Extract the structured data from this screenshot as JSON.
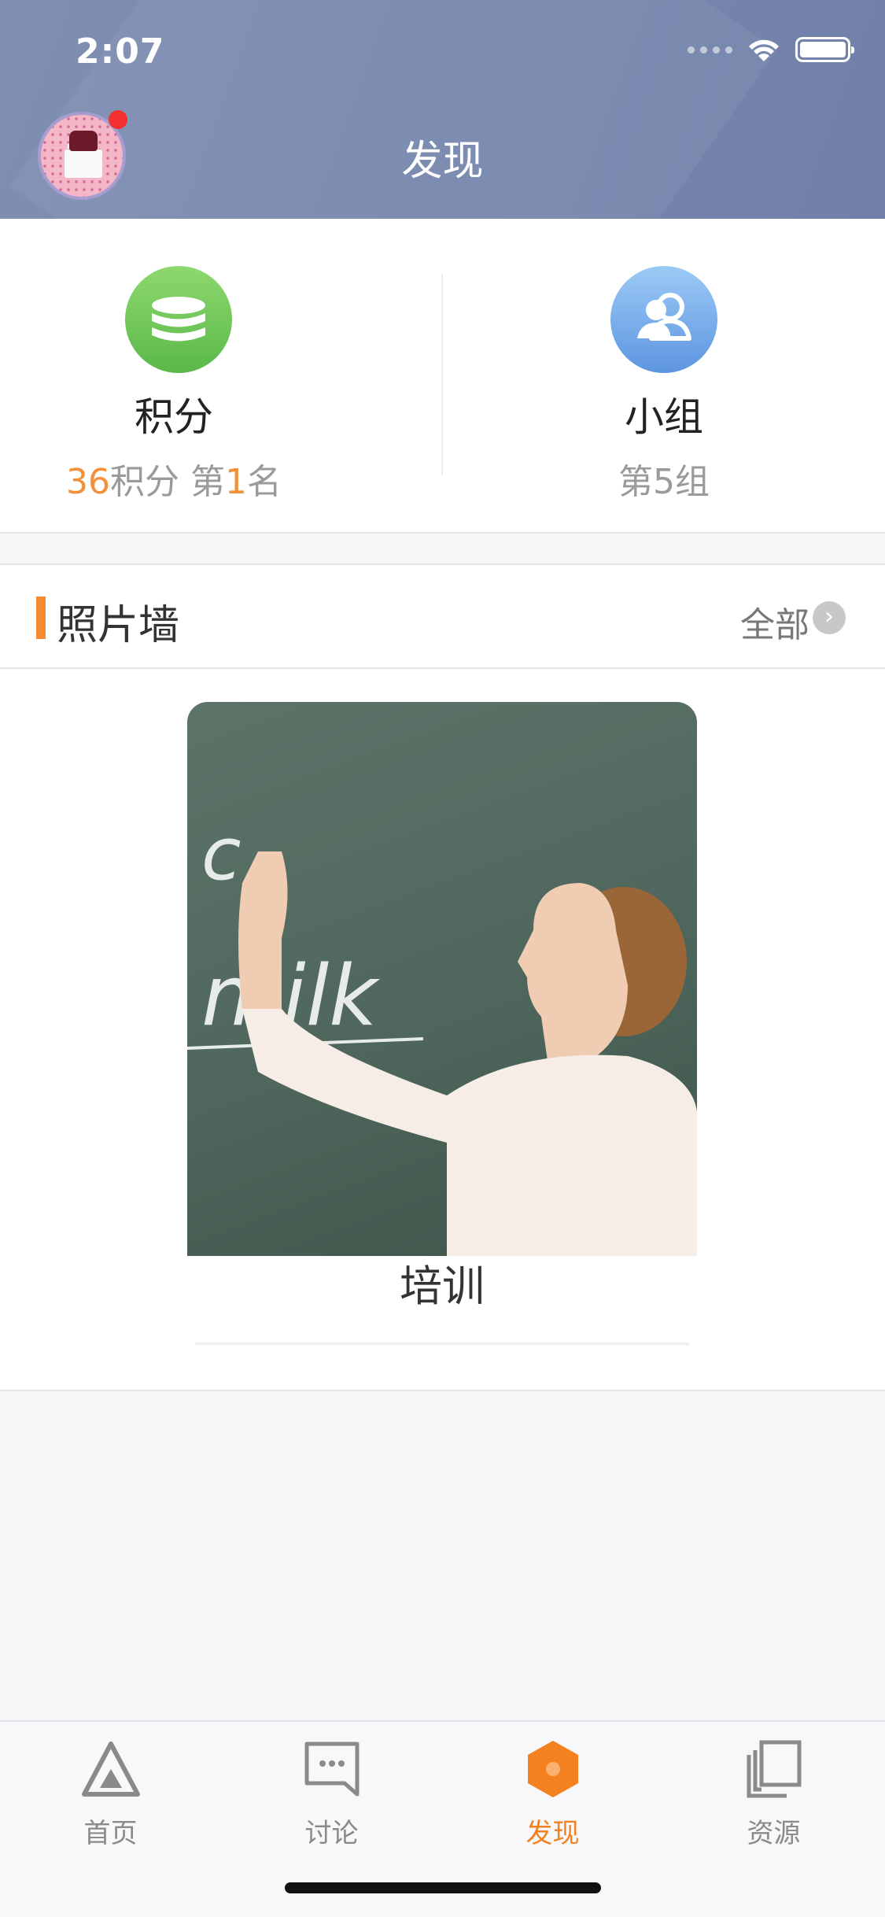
{
  "status_bar": {
    "time": "2:07"
  },
  "header": {
    "title": "发现"
  },
  "stats": {
    "points": {
      "label": "积分",
      "value": "36",
      "value_suffix": "积分 第",
      "rank": "1",
      "rank_suffix": "名"
    },
    "group": {
      "label": "小组",
      "value": "第5组"
    }
  },
  "photo_wall": {
    "title": "照片墙",
    "all_label": "全部",
    "items": [
      {
        "caption": "培训"
      }
    ]
  },
  "photo_text": {
    "line1": "c",
    "line2": "milk"
  },
  "tabbar": {
    "items": [
      {
        "label": "首页",
        "icon": "home-triangle-icon"
      },
      {
        "label": "讨论",
        "icon": "chat-bubble-icon"
      },
      {
        "label": "发现",
        "icon": "hexagon-icon",
        "active": true
      },
      {
        "label": "资源",
        "icon": "documents-icon"
      }
    ]
  },
  "colors": {
    "accent": "#f5801f",
    "header": "#7585aa",
    "green": "#6cc656",
    "blue": "#6aa3e8"
  }
}
